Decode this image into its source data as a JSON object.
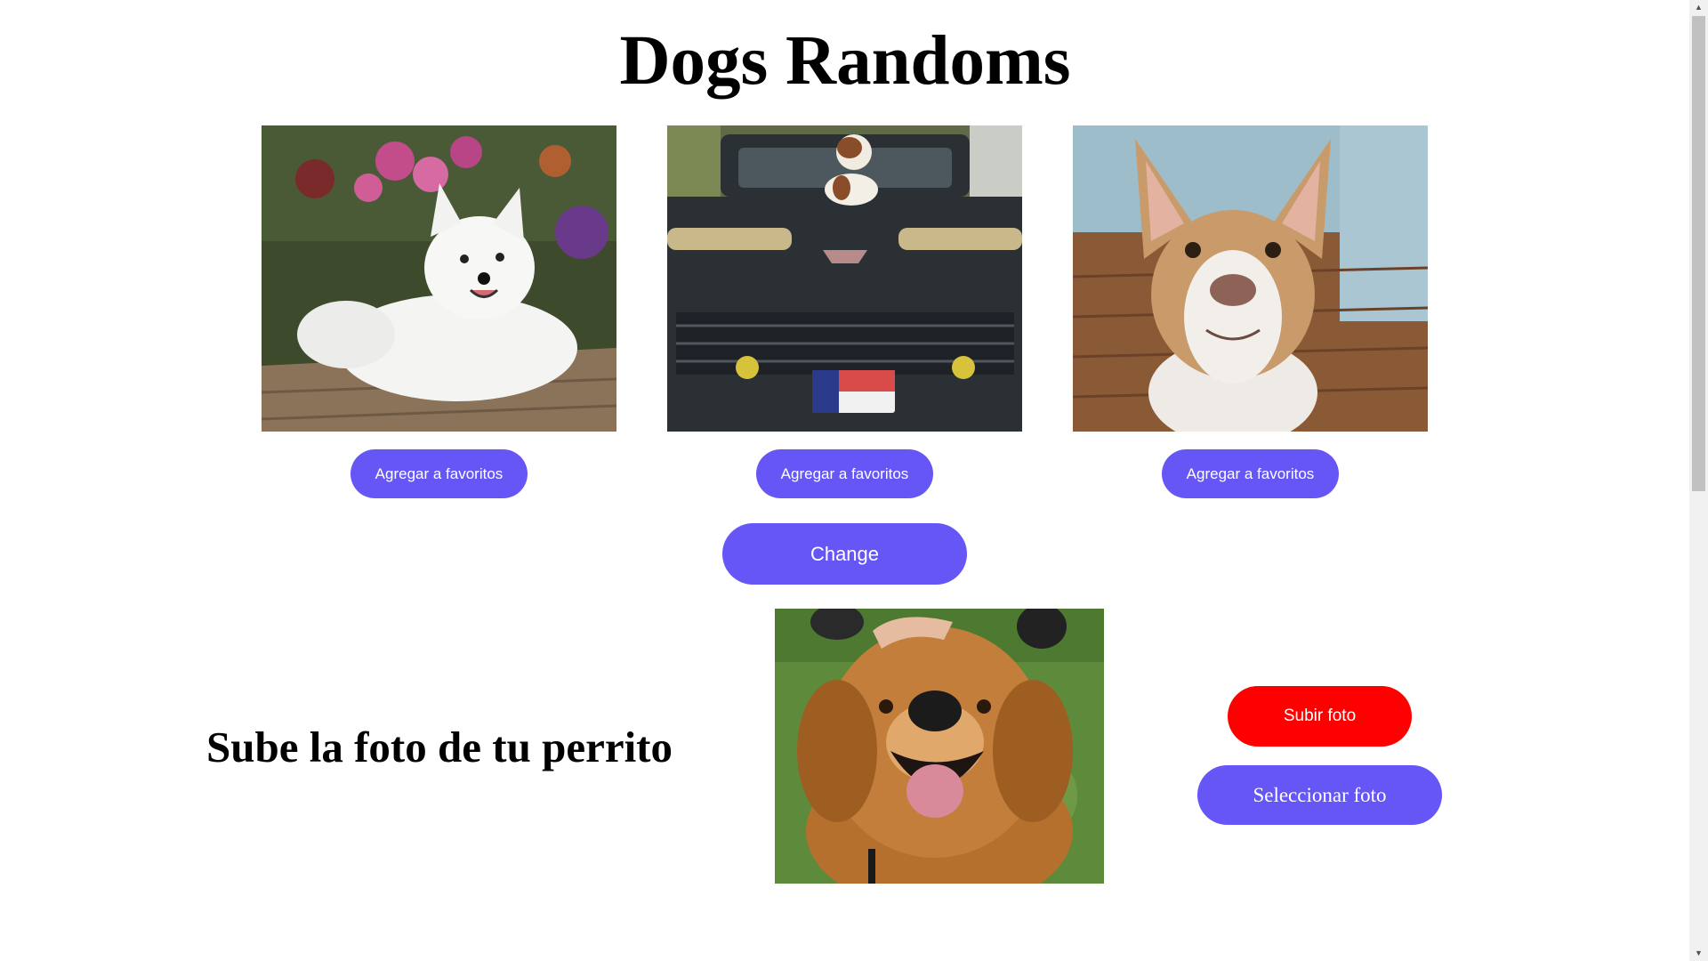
{
  "page": {
    "title": "Dogs Randoms"
  },
  "random_dogs": {
    "cards": [
      {
        "image": "white-spitz-dog-photo",
        "button_label": "Agregar a favoritos"
      },
      {
        "image": "puppy-on-truck-photo",
        "button_label": "Agregar a favoritos"
      },
      {
        "image": "pitbull-dog-photo",
        "button_label": "Agregar a favoritos"
      }
    ],
    "change_label": "Change"
  },
  "upload": {
    "heading": "Sube la foto de tu perrito",
    "preview_image": "golden-retriever-photo",
    "upload_label": "Subir foto",
    "select_label": "Seleccionar foto"
  },
  "colors": {
    "primary_button": "#6656f5",
    "upload_button": "#ff0000",
    "text": "#000000",
    "background": "#ffffff"
  }
}
